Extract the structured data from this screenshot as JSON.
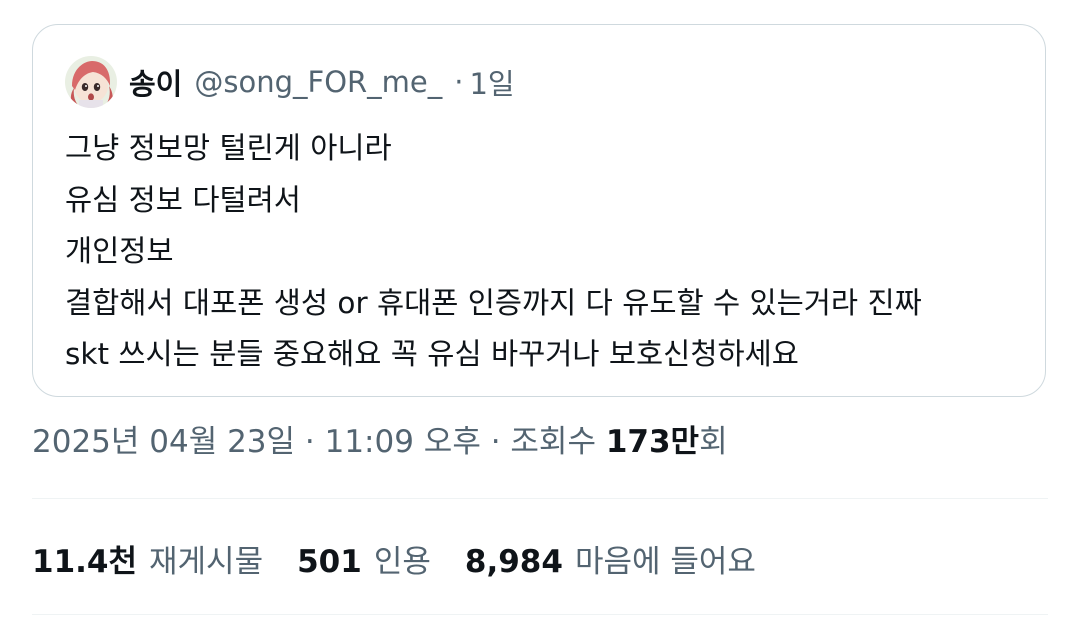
{
  "quoted_tweet": {
    "display_name": "송이",
    "handle": "@song_FOR_me_",
    "separator": "·",
    "time_ago": "1일",
    "lines": [
      "그냥 정보망 털린게 아니라",
      "유심 정보 다털려서",
      "개인정보",
      "결합해서 대포폰 생성 or 휴대폰 인증까지 다 유도할 수 있는거라 진짜",
      "skt 쓰시는 분들 중요해요 꼭 유심 바꾸거나 보호신청하세요"
    ]
  },
  "meta": {
    "date_time": "2025년 04월 23일 · 11:09 오후 · 조회수 ",
    "views_number": "173만",
    "views_suffix": "회"
  },
  "stats": {
    "reposts_count": "11.4천",
    "reposts_label": "재게시물",
    "quotes_count": "501",
    "quotes_label": "인용",
    "likes_count": "8,984",
    "likes_label": "마음에 들어요"
  },
  "colors": {
    "text_primary": "#0f1419",
    "text_secondary": "#536471",
    "border": "#cfd9de",
    "divider": "#eff3f4"
  }
}
